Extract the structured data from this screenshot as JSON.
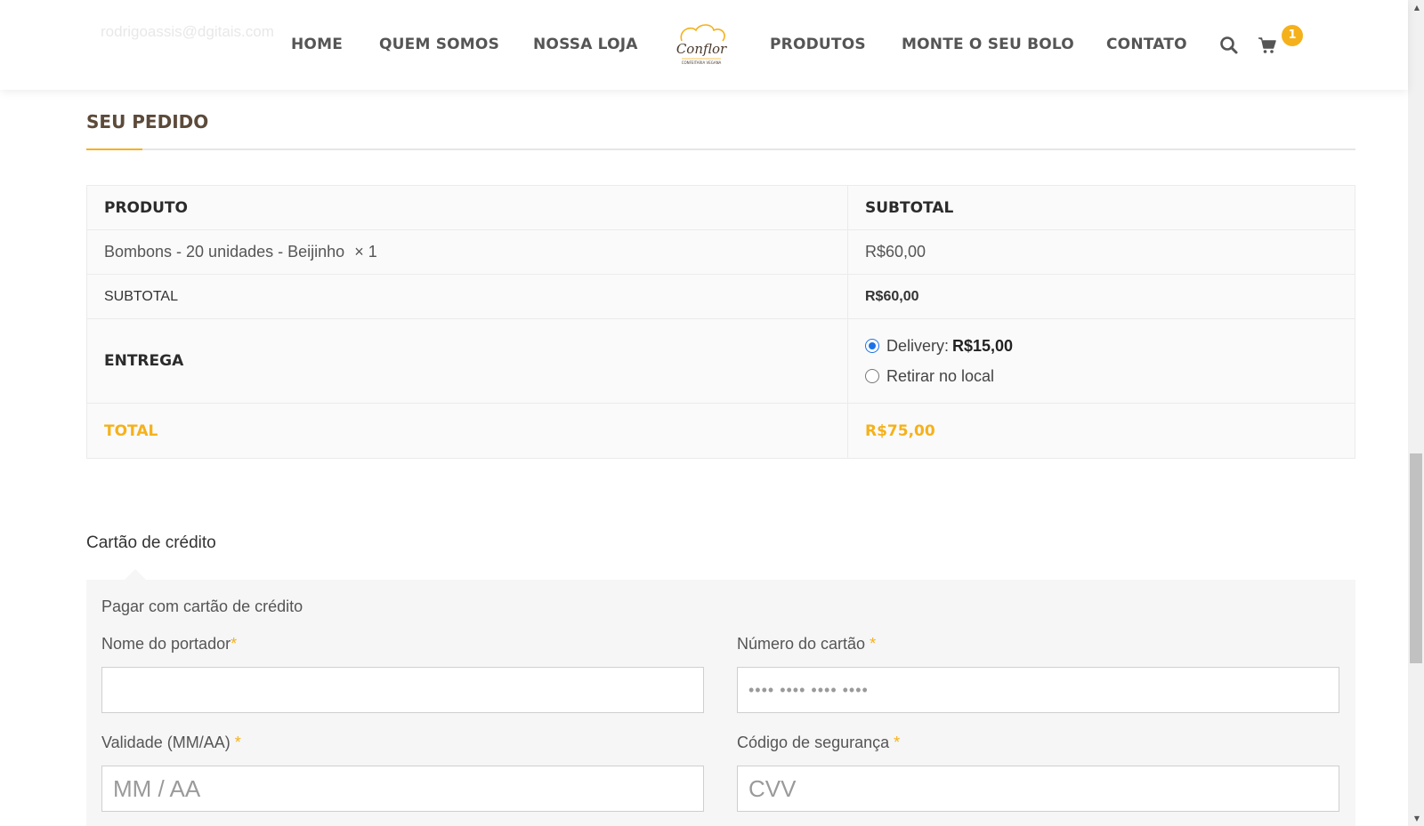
{
  "header": {
    "ghost_email": "rodrigoassis@dgitais.com",
    "nav": [
      {
        "label": "HOME"
      },
      {
        "label": "QUEM SOMOS"
      },
      {
        "label": "NOSSA LOJA"
      },
      {
        "label": "PRODUTOS"
      },
      {
        "label": "MONTE O SEU BOLO"
      },
      {
        "label": "CONTATO"
      }
    ],
    "logo": {
      "name": "Conflor",
      "tagline": "CONFEITARIA VEGANA"
    },
    "cart_count": "1",
    "icons": {
      "search": "search-icon",
      "cart": "cart-icon"
    },
    "accent_color": "#f5b11c"
  },
  "order": {
    "title": "SEU PEDIDO",
    "col_product": "PRODUTO",
    "col_subtotal": "SUBTOTAL",
    "item_name": "Bombons - 20 unidades - Beijinho",
    "item_qty": "× 1",
    "item_price": "R$60,00",
    "subtotal_label": "SUBTOTAL",
    "subtotal_value": "R$60,00",
    "shipping_label": "ENTREGA",
    "shipping_options": [
      {
        "label": "Delivery:",
        "price": "R$15,00",
        "selected": true
      },
      {
        "label": "Retirar no local",
        "price": "",
        "selected": false
      }
    ],
    "total_label": "TOTAL",
    "total_value": "R$75,00"
  },
  "payment": {
    "method_tab": "Cartão de crédito",
    "description": "Pagar com cartão de crédito",
    "holder_label": "Nome do portador",
    "holder_value": "",
    "card_label": "Número do cartão ",
    "card_placeholder": "•••• •••• •••• ••••",
    "expiry_label": "Validade (MM/AA) ",
    "expiry_placeholder": "MM / AA",
    "cvv_label": "Código de segurança ",
    "cvv_placeholder": "CVV",
    "required_mark": "*"
  }
}
